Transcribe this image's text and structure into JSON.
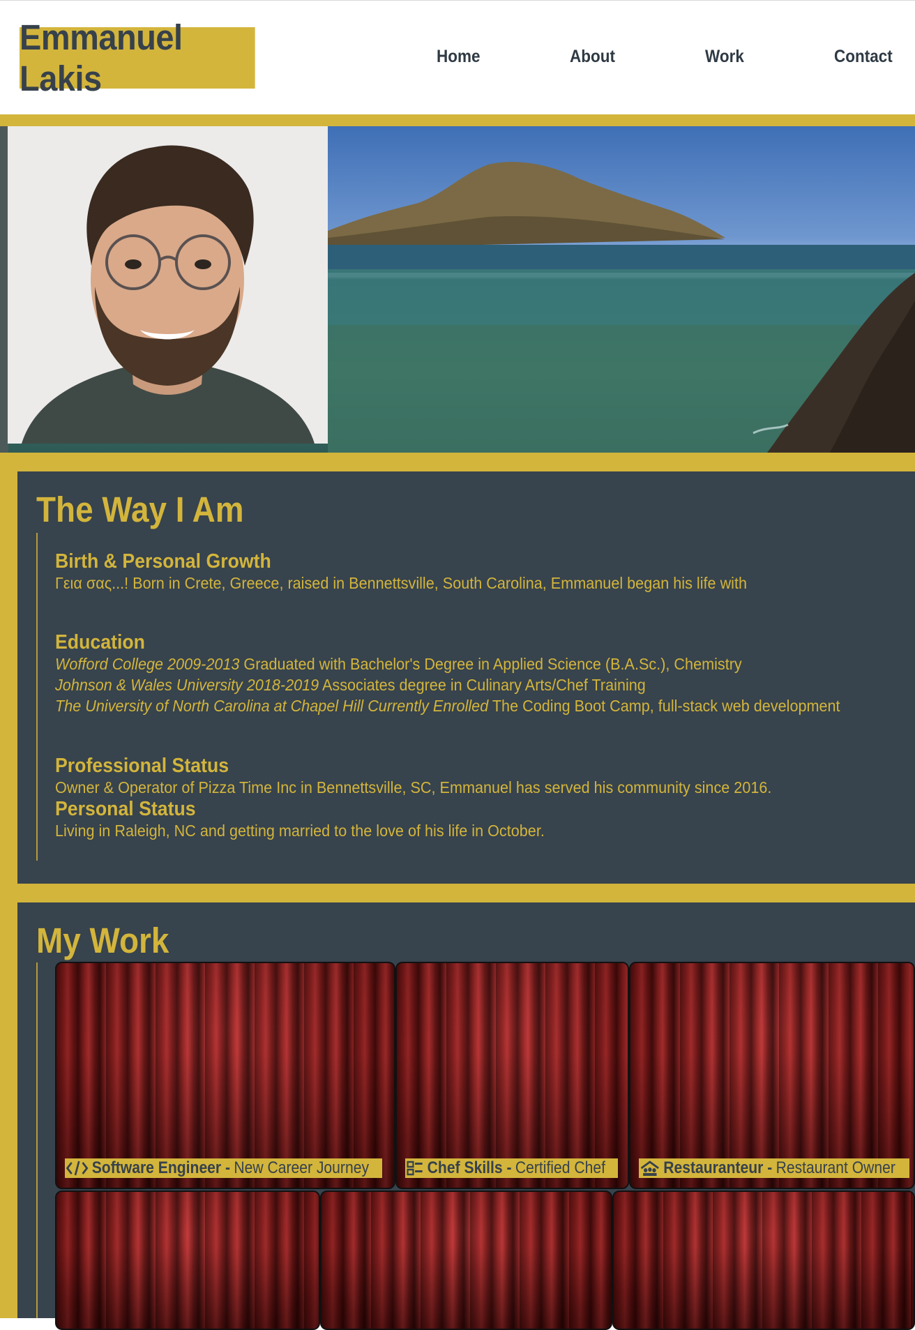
{
  "header": {
    "logo": "Emmanuel Lakis",
    "nav": [
      {
        "label": "Home"
      },
      {
        "label": "About"
      },
      {
        "label": "Work"
      },
      {
        "label": "Contact"
      }
    ]
  },
  "colors": {
    "accent": "#d3b53c",
    "panel": "#37434d",
    "text_dark": "#37414b"
  },
  "about": {
    "title": "The Way I Am",
    "birth": {
      "heading": "Birth & Personal Growth",
      "text": "Γεια σας...! Born in Crete, Greece, raised in Bennettsville, South Carolina, Emmanuel began his life with"
    },
    "education": {
      "heading": "Education",
      "items": [
        {
          "school": "Wofford College 2009-2013",
          "detail": " Graduated with Bachelor's Degree in Applied Science (B.A.Sc.), Chemistry"
        },
        {
          "school": "Johnson & Wales University 2018-2019",
          "detail": " Associates degree in Culinary Arts/Chef Training"
        },
        {
          "school": "The University of North Carolina at Chapel Hill Currently Enrolled",
          "detail": " The Coding Boot Camp, full-stack web development"
        }
      ]
    },
    "professional": {
      "heading": "Professional Status",
      "text": "Owner & Operator of Pizza Time Inc in Bennettsville, SC, Emmanuel has served his community since 2016."
    },
    "personal": {
      "heading": "Personal Status",
      "text": "Living in Raleigh, NC and getting married to the love of his life in October."
    }
  },
  "work": {
    "title": "My Work",
    "cards": [
      {
        "icon": "code-icon",
        "title": "Software Engineer - ",
        "subtitle": "New Career Journey"
      },
      {
        "icon": "chef-skills-icon",
        "title": "Chef Skills - ",
        "subtitle": "Certified Chef"
      },
      {
        "icon": "restaurant-icon",
        "title": "Restauranteur - ",
        "subtitle": "Restaurant Owner"
      }
    ]
  }
}
